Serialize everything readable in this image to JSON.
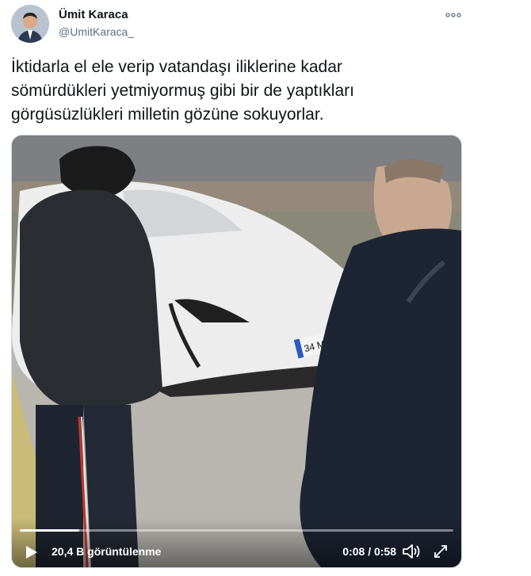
{
  "author": {
    "name": "Ümit Karaca",
    "handle": "@UmitKaraca_"
  },
  "tweet": {
    "text": "İktidarla el ele verip vatandaşı iliklerine kadar\nsömürdükleri yetmiyormuş gibi bir de yaptıkları\ngörgüsüzlükleri milletin gözüne sokuyorlar."
  },
  "video": {
    "views": "20,4 B görüntülenme",
    "time": "0:08 / 0:58",
    "progress_fraction": 0.138,
    "plate_text": "34 M",
    "icons": {
      "more": "more-icon",
      "play": "play-icon",
      "volume": "volume-icon",
      "fullscreen": "fullscreen-icon"
    }
  }
}
